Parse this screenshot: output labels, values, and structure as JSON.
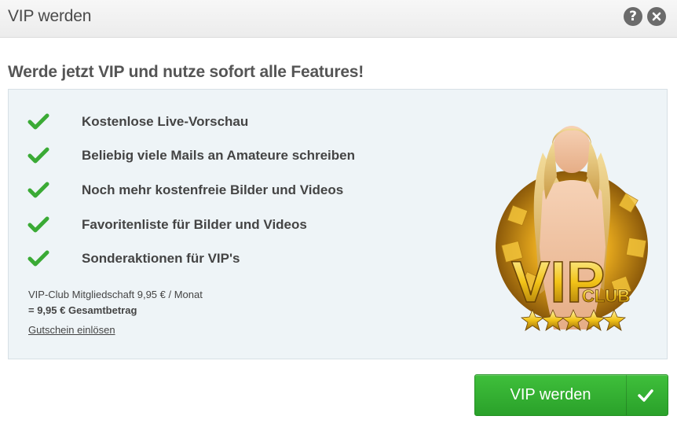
{
  "header": {
    "title": "VIP werden",
    "help_icon": "help-icon",
    "help_glyph": "?",
    "close_icon": "close-icon"
  },
  "headline": "Werde jetzt VIP und nutze sofort alle Features!",
  "features": [
    "Kostenlose Live-Vorschau",
    "Beliebig viele Mails an Amateure schreiben",
    "Noch mehr kostenfreie Bilder und Videos",
    "Favoritenliste für Bilder und Videos",
    "Sonderaktionen für VIP's"
  ],
  "pricing": {
    "membership": "VIP-Club Mitgliedschaft 9,95 € / Monat",
    "total": "= 9,95 € Gesamtbetrag"
  },
  "voucher_link": "Gutschein einlösen",
  "badge": {
    "vip_text": "VIP",
    "club_text": "CLUB"
  },
  "cta": {
    "label": "VIP werden",
    "icon": "checkmark-icon"
  },
  "colors": {
    "accent_green": "#2fae2c",
    "check_green": "#3aaa35",
    "panel_bg": "#eef4f7",
    "gold": "#f2c318"
  }
}
